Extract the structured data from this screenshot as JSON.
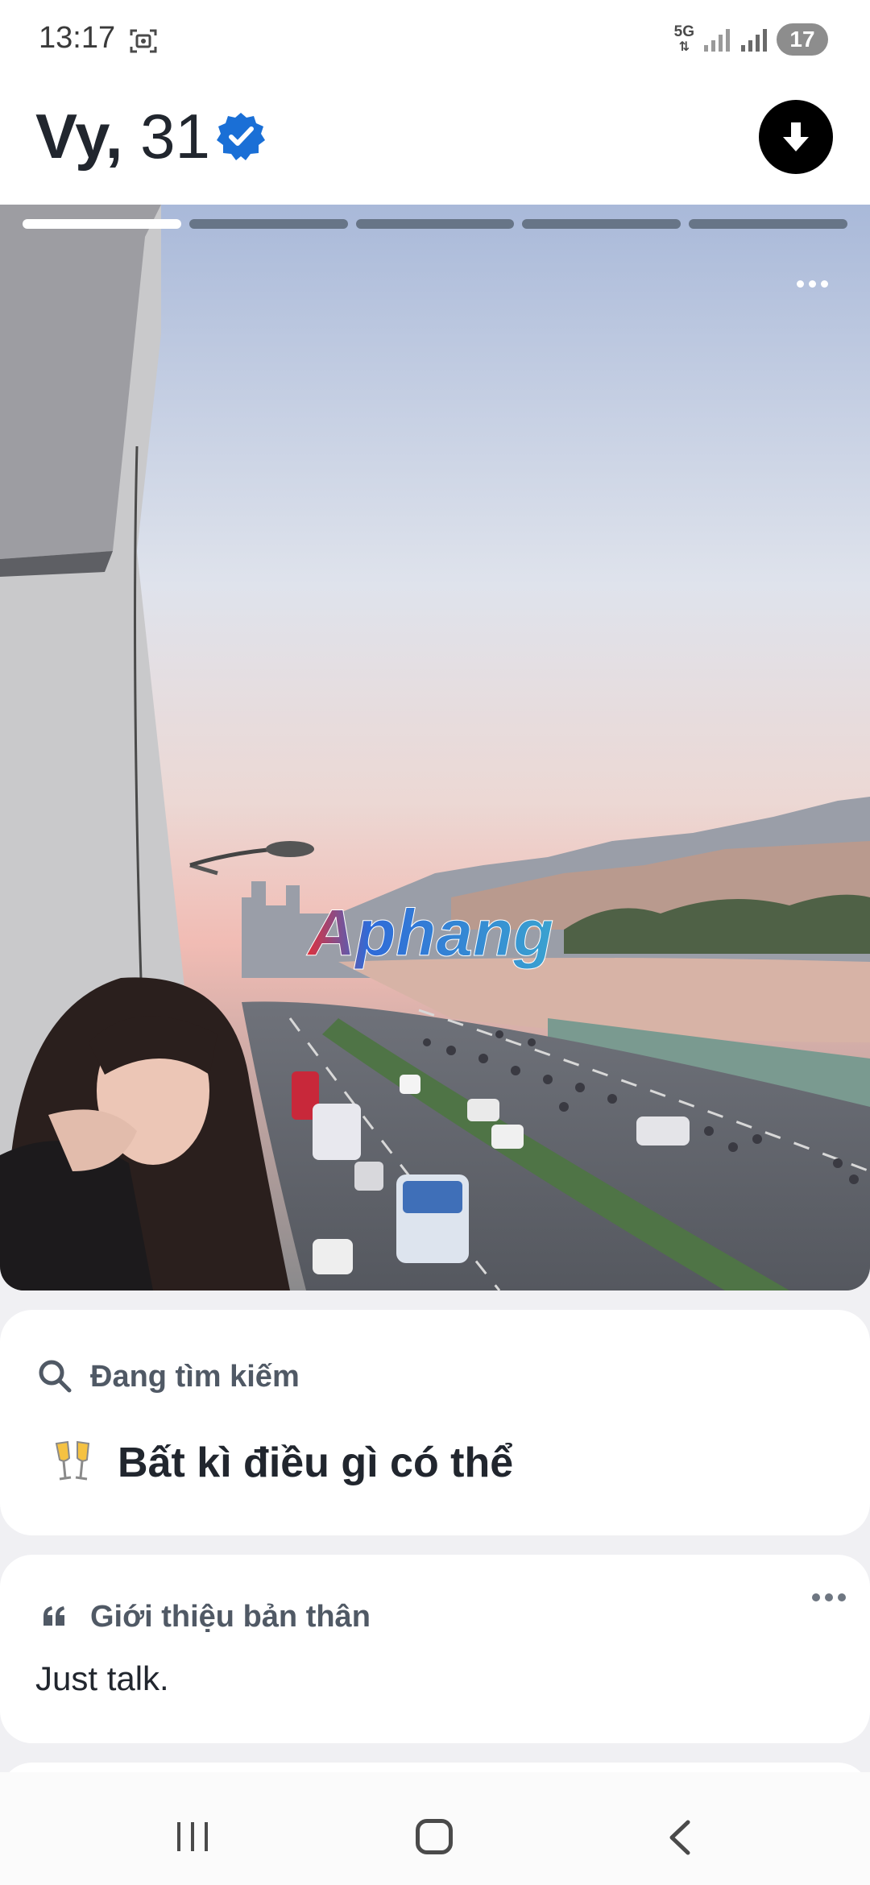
{
  "status_bar": {
    "time": "13:17",
    "network": "5G",
    "battery": "17",
    "icons": [
      "screen-record-icon",
      "signal-icon",
      "signal-icon",
      "battery-icon"
    ]
  },
  "profile": {
    "name": "Vy,",
    "age": "31",
    "verified": true,
    "verified_color": "#1a6fd6",
    "download_button_icon": "arrow-down-icon"
  },
  "photo": {
    "segments_total": 5,
    "active_segment": 1,
    "watermark": "Aphang",
    "menu_icon": "more-horizontal-icon"
  },
  "looking_for": {
    "label": "Đang tìm kiếm",
    "icon": "search-icon",
    "emoji_icon": "clinking-glasses-icon",
    "value": "Bất kì điều gì có thể"
  },
  "about": {
    "label": "Giới thiệu bản thân",
    "icon": "quote-icon",
    "text": "Just talk.",
    "menu_icon": "more-horizontal-icon"
  },
  "nav": {
    "recent_icon": "recent-apps-icon",
    "home_icon": "home-icon",
    "back_icon": "back-icon"
  }
}
